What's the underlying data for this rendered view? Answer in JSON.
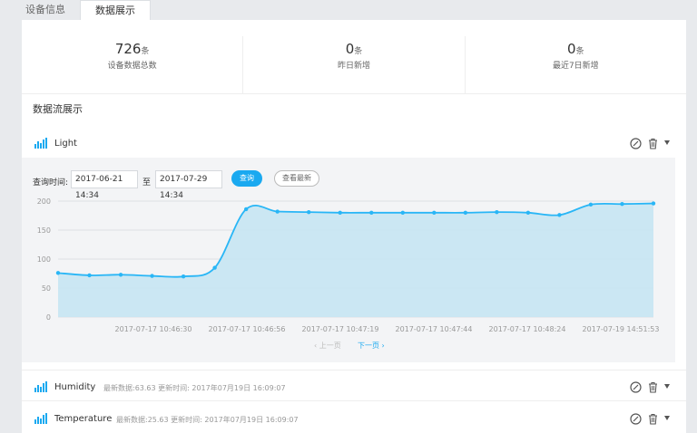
{
  "tabs": [
    {
      "label": "设备信息",
      "active": false
    },
    {
      "label": "数据展示",
      "active": true
    }
  ],
  "stats": [
    {
      "value": "726",
      "unit": "条",
      "label": "设备数据总数"
    },
    {
      "value": "0",
      "unit": "条",
      "label": "昨日新增"
    },
    {
      "value": "0",
      "unit": "条",
      "label": "最近7日新增"
    }
  ],
  "section_title": "数据流展示",
  "streams": [
    {
      "name": "Light",
      "meta": ""
    },
    {
      "name": "Humidity",
      "meta": "最新数据:63.63 更新时间: 2017年07月19日 16:09:07"
    },
    {
      "name": "Temperature",
      "meta": "最新数据:25.63 更新时间: 2017年07月19日 16:09:07"
    }
  ],
  "query": {
    "label": "查询时间:",
    "start": "2017-06-21 14:34",
    "to": "至",
    "end": "2017-07-29 14:34",
    "query_button": "查询",
    "latest_button": "查看最新"
  },
  "pager": {
    "prev": "‹ 上一页",
    "next": "下一页 ›"
  },
  "colors": {
    "accent": "#1aa9f0",
    "line": "#29b6f6",
    "area": "#c7e5f3"
  },
  "icons": [
    "bar-chart-icon",
    "edit-icon",
    "trash-icon",
    "caret-down-icon"
  ],
  "chart_data": {
    "type": "area",
    "title": "",
    "xlabel": "",
    "ylabel": "",
    "ylim": [
      0,
      200
    ],
    "yticks": [
      0,
      50,
      100,
      150,
      200
    ],
    "x_tick_labels": [
      "2017-07-17 10:46:30",
      "2017-07-17 10:46:56",
      "2017-07-17 10:47:19",
      "2017-07-17 10:47:44",
      "2017-07-17 10:48:24",
      "2017-07-19 14:51:53"
    ],
    "grid": true,
    "series": [
      {
        "values": [
          76,
          72,
          73,
          71,
          70,
          85,
          186,
          182,
          181,
          180,
          180,
          180,
          180,
          180,
          181,
          180,
          176,
          194,
          195,
          196
        ]
      }
    ]
  }
}
